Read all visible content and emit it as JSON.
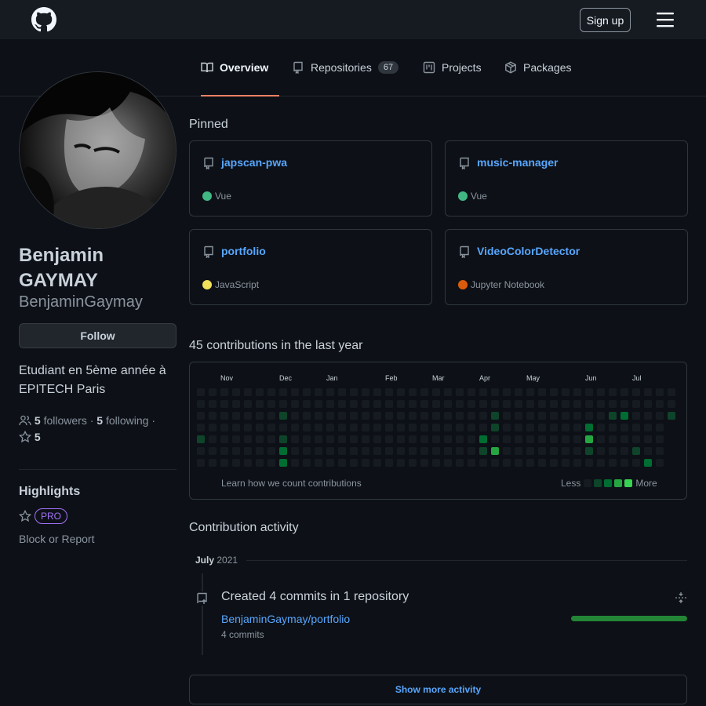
{
  "header": {
    "logo_icon": "github-mark-icon",
    "signup_label": "Sign up",
    "menu_icon": "hamburger-icon"
  },
  "tabs": [
    {
      "label": "Overview",
      "icon": "book-icon",
      "active": true
    },
    {
      "label": "Repositories",
      "icon": "repo-icon",
      "count": "67"
    },
    {
      "label": "Projects",
      "icon": "project-icon"
    },
    {
      "label": "Packages",
      "icon": "package-icon"
    }
  ],
  "profile": {
    "name": "Benjamin GAYMAY",
    "login": "BenjaminGaymay",
    "follow_label": "Follow",
    "bio": "Etudiant en 5ème année à EPITECH Paris",
    "followers_count": "5",
    "followers_label": "followers",
    "following_count": "5",
    "following_label": "following",
    "stars_count": "5"
  },
  "highlights": {
    "title": "Highlights",
    "badge": "PRO",
    "block_label": "Block or Report"
  },
  "pinned": {
    "title": "Pinned",
    "repos": [
      {
        "name": "japscan-pwa",
        "language": "Vue",
        "color": "#41b883"
      },
      {
        "name": "music-manager",
        "language": "Vue",
        "color": "#41b883"
      },
      {
        "name": "portfolio",
        "language": "JavaScript",
        "color": "#f1e05a"
      },
      {
        "name": "VideoColorDetector",
        "language": "Jupyter Notebook",
        "color": "#DA5B0B"
      }
    ]
  },
  "contributions": {
    "title": "45 contributions in the last year",
    "months": [
      {
        "label": "Nov",
        "week": 2
      },
      {
        "label": "Dec",
        "week": 7
      },
      {
        "label": "Jan",
        "week": 11
      },
      {
        "label": "Feb",
        "week": 16
      },
      {
        "label": "Mar",
        "week": 20
      },
      {
        "label": "Apr",
        "week": 24
      },
      {
        "label": "May",
        "week": 28
      },
      {
        "label": "Jun",
        "week": 33
      },
      {
        "label": "Jul",
        "week": 37
      }
    ],
    "weeks": 40,
    "active_cells": [
      {
        "week": 0,
        "day": 4,
        "level": 1
      },
      {
        "week": 7,
        "day": 2,
        "level": 1
      },
      {
        "week": 7,
        "day": 4,
        "level": 1
      },
      {
        "week": 7,
        "day": 5,
        "level": 2
      },
      {
        "week": 7,
        "day": 6,
        "level": 2
      },
      {
        "week": 24,
        "day": 4,
        "level": 2
      },
      {
        "week": 24,
        "day": 5,
        "level": 1
      },
      {
        "week": 25,
        "day": 2,
        "level": 1
      },
      {
        "week": 25,
        "day": 3,
        "level": 1
      },
      {
        "week": 25,
        "day": 5,
        "level": 3
      },
      {
        "week": 33,
        "day": 3,
        "level": 2
      },
      {
        "week": 33,
        "day": 4,
        "level": 3
      },
      {
        "week": 33,
        "day": 5,
        "level": 1
      },
      {
        "week": 35,
        "day": 2,
        "level": 1
      },
      {
        "week": 36,
        "day": 2,
        "level": 2
      },
      {
        "week": 37,
        "day": 5,
        "level": 1
      },
      {
        "week": 38,
        "day": 6,
        "level": 2
      },
      {
        "week": 40,
        "day": 2,
        "level": 1
      }
    ],
    "help_link": "Learn how we count contributions",
    "legend_less": "Less",
    "legend_more": "More",
    "level_colors": [
      "#161b22",
      "#0e4429",
      "#006d32",
      "#26a641",
      "#39d353"
    ]
  },
  "activity": {
    "title": "Contribution activity",
    "month": "July",
    "year": "2021",
    "summary": "Created 4 commits in 1 repository",
    "repo": "BenjaminGaymay/portfolio",
    "commits": "4 commits",
    "bar_fraction": 1.0,
    "show_more": "Show more activity"
  }
}
